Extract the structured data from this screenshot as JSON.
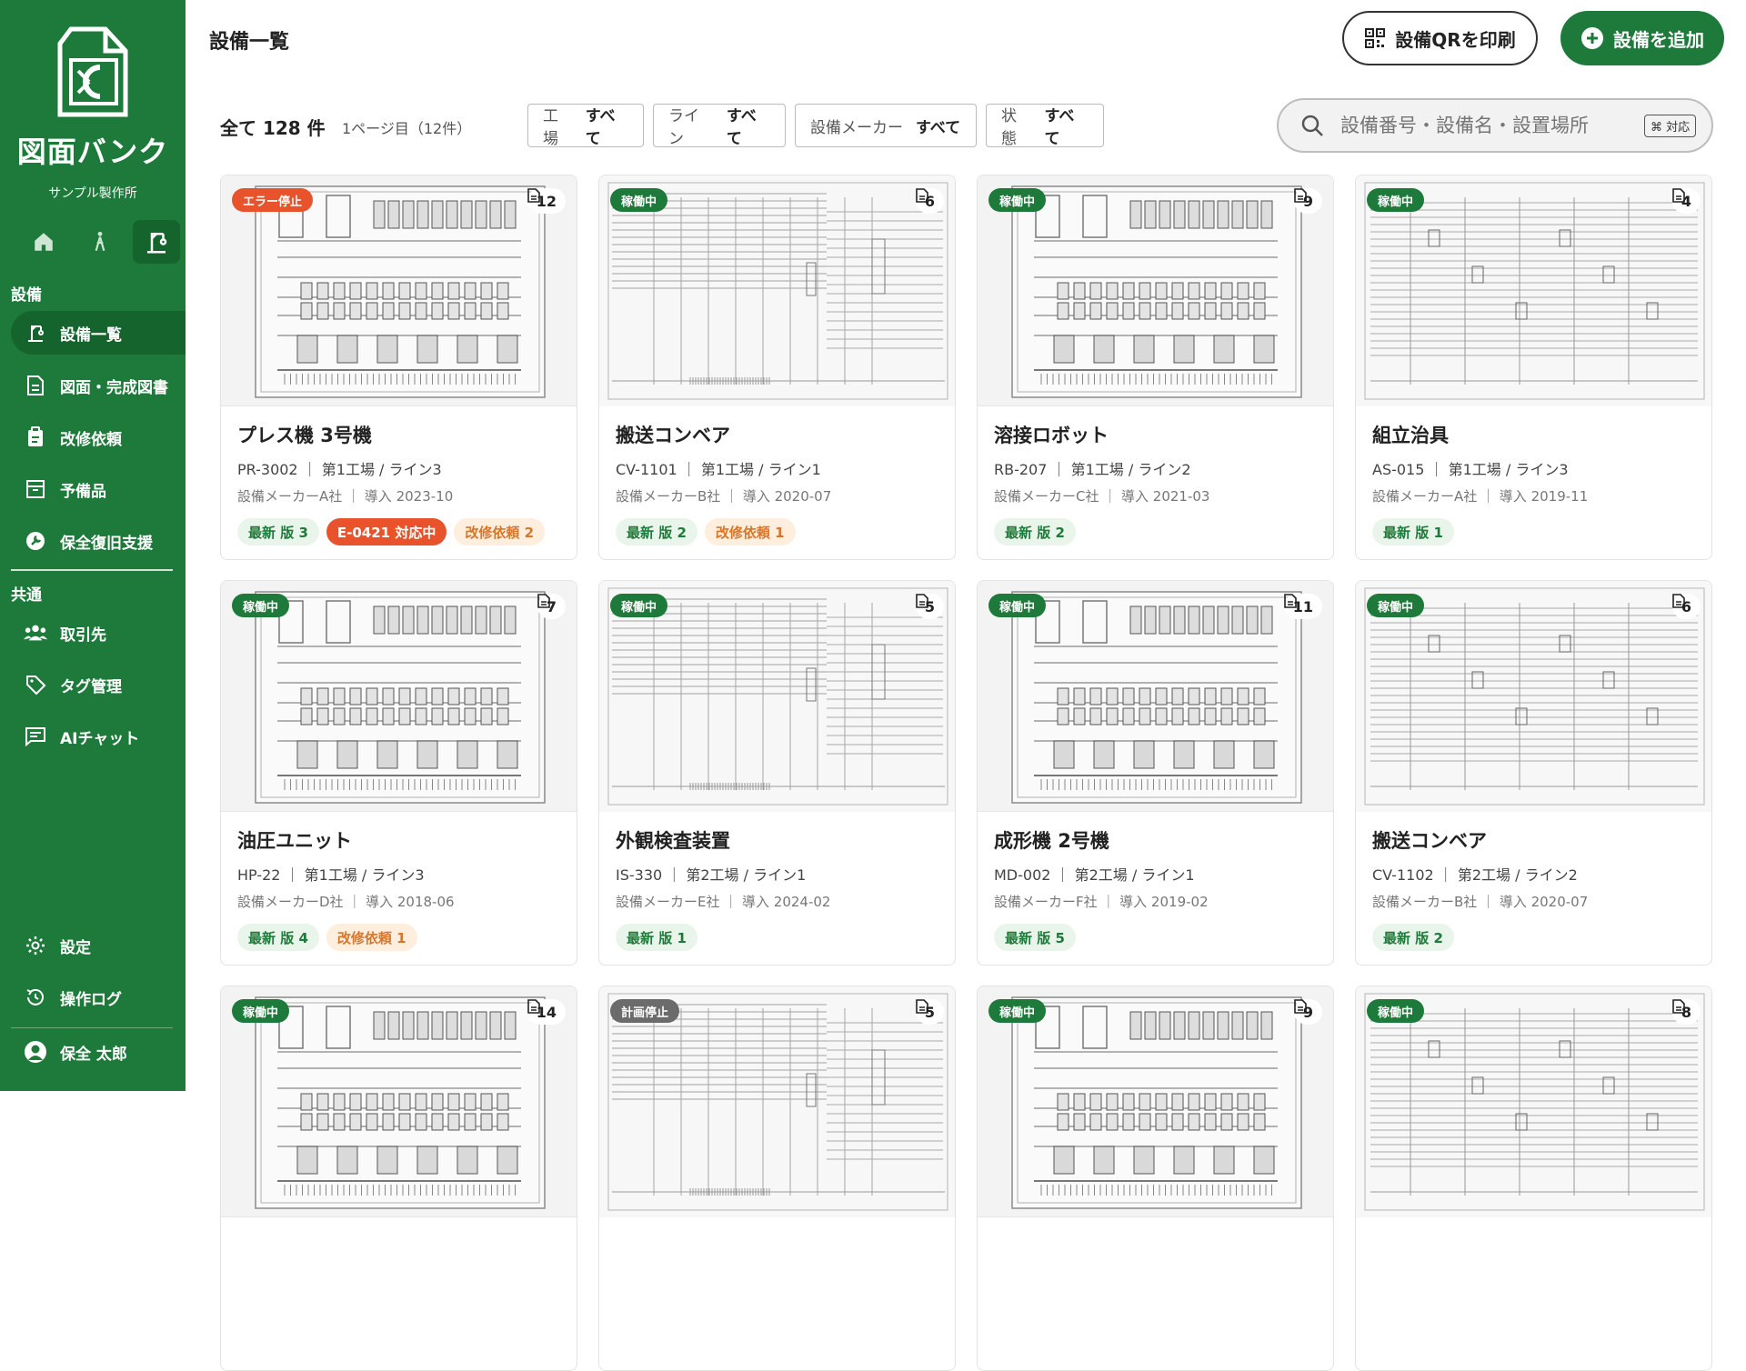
{
  "app": {
    "name": "図面バンク",
    "company": "サンプル製作所"
  },
  "sidebar": {
    "section_equipment": "設備",
    "section_common": "共通",
    "items": [
      {
        "label": "設備一覧"
      },
      {
        "label": "図面・完成図書"
      },
      {
        "label": "改修依頼"
      },
      {
        "label": "予備品"
      },
      {
        "label": "保全復旧支援"
      },
      {
        "label": "取引先"
      },
      {
        "label": "タグ管理"
      },
      {
        "label": "AIチャット"
      },
      {
        "label": "設定"
      },
      {
        "label": "操作ログ"
      }
    ],
    "user": "保全 太郎"
  },
  "header": {
    "title": "設備一覧",
    "print_qr": "設備QRを印刷",
    "add_equipment": "設備を追加"
  },
  "toolbar": {
    "total": "全て 128 件",
    "page_info": "1ページ目（12件）",
    "filters": [
      {
        "label": "工場",
        "value": "すべて"
      },
      {
        "label": "ライン",
        "value": "すべて"
      },
      {
        "label": "設備メーカー",
        "value": "すべて"
      },
      {
        "label": "状態",
        "value": "すべて"
      }
    ],
    "search_placeholder": "設備番号・設備名・設置場所",
    "search_hint": "⌘ 対応"
  },
  "colors": {
    "brand": "#1e7a3a",
    "error": "#e8532b",
    "request": "#d8762b",
    "stopped": "#6b6b6b"
  },
  "cards": [
    {
      "status": "エラー停止",
      "status_type": "error",
      "docs": "12",
      "name": "プレス機 3号機",
      "meta1": "PR-3002 ｜ 第1工場 / ライン3",
      "meta2": "設備メーカーA社 ｜ 導入 2023-10",
      "tags": [
        {
          "text": "最新 版 3",
          "type": "latest"
        },
        {
          "text": "E-0421 対応中",
          "type": "err"
        },
        {
          "text": "改修依頼 2",
          "type": "req"
        }
      ],
      "thumb": "panel"
    },
    {
      "status": "稼働中",
      "status_type": "running",
      "docs": "6",
      "name": "搬送コンベア",
      "meta1": "CV-1101 ｜ 第1工場 / ライン1",
      "meta2": "設備メーカーB社 ｜ 導入 2020-07",
      "tags": [
        {
          "text": "最新 版 2",
          "type": "latest"
        },
        {
          "text": "改修依頼 1",
          "type": "req"
        }
      ],
      "thumb": "schematic"
    },
    {
      "status": "稼働中",
      "status_type": "running",
      "docs": "9",
      "name": "溶接ロボット",
      "meta1": "RB-207 ｜ 第1工場 / ライン2",
      "meta2": "設備メーカーC社 ｜ 導入 2021-03",
      "tags": [
        {
          "text": "最新 版 2",
          "type": "latest"
        }
      ],
      "thumb": "panel"
    },
    {
      "status": "稼働中",
      "status_type": "running",
      "docs": "4",
      "name": "組立治具",
      "meta1": "AS-015 ｜ 第1工場 / ライン3",
      "meta2": "設備メーカーA社 ｜ 導入 2019-11",
      "tags": [
        {
          "text": "最新 版 1",
          "type": "latest"
        }
      ],
      "thumb": "ladder"
    },
    {
      "status": "稼働中",
      "status_type": "running",
      "docs": "7",
      "name": "油圧ユニット",
      "meta1": "HP-22 ｜ 第1工場 / ライン3",
      "meta2": "設備メーカーD社 ｜ 導入 2018-06",
      "tags": [
        {
          "text": "最新 版 4",
          "type": "latest"
        },
        {
          "text": "改修依頼 1",
          "type": "req"
        }
      ],
      "thumb": "panel"
    },
    {
      "status": "稼働中",
      "status_type": "running",
      "docs": "5",
      "name": "外観検査装置",
      "meta1": "IS-330 ｜ 第2工場 / ライン1",
      "meta2": "設備メーカーE社 ｜ 導入 2024-02",
      "tags": [
        {
          "text": "最新 版 1",
          "type": "latest"
        }
      ],
      "thumb": "schematic"
    },
    {
      "status": "稼働中",
      "status_type": "running",
      "docs": "11",
      "name": "成形機 2号機",
      "meta1": "MD-002 ｜ 第2工場 / ライン1",
      "meta2": "設備メーカーF社 ｜ 導入 2019-02",
      "tags": [
        {
          "text": "最新 版 5",
          "type": "latest"
        }
      ],
      "thumb": "panel"
    },
    {
      "status": "稼働中",
      "status_type": "running",
      "docs": "6",
      "name": "搬送コンベア",
      "meta1": "CV-1102 ｜ 第2工場 / ライン2",
      "meta2": "設備メーカーB社 ｜ 導入 2020-07",
      "tags": [
        {
          "text": "最新 版 2",
          "type": "latest"
        }
      ],
      "thumb": "ladder"
    },
    {
      "status": "稼働中",
      "status_type": "running",
      "docs": "14",
      "name": "",
      "meta1": "",
      "meta2": "",
      "tags": [],
      "thumb": "panel"
    },
    {
      "status": "計画停止",
      "status_type": "stopped",
      "docs": "5",
      "name": "",
      "meta1": "",
      "meta2": "",
      "tags": [],
      "thumb": "schematic"
    },
    {
      "status": "稼働中",
      "status_type": "running",
      "docs": "9",
      "name": "",
      "meta1": "",
      "meta2": "",
      "tags": [],
      "thumb": "panel"
    },
    {
      "status": "稼働中",
      "status_type": "running",
      "docs": "8",
      "name": "",
      "meta1": "",
      "meta2": "",
      "tags": [],
      "thumb": "ladder"
    }
  ]
}
